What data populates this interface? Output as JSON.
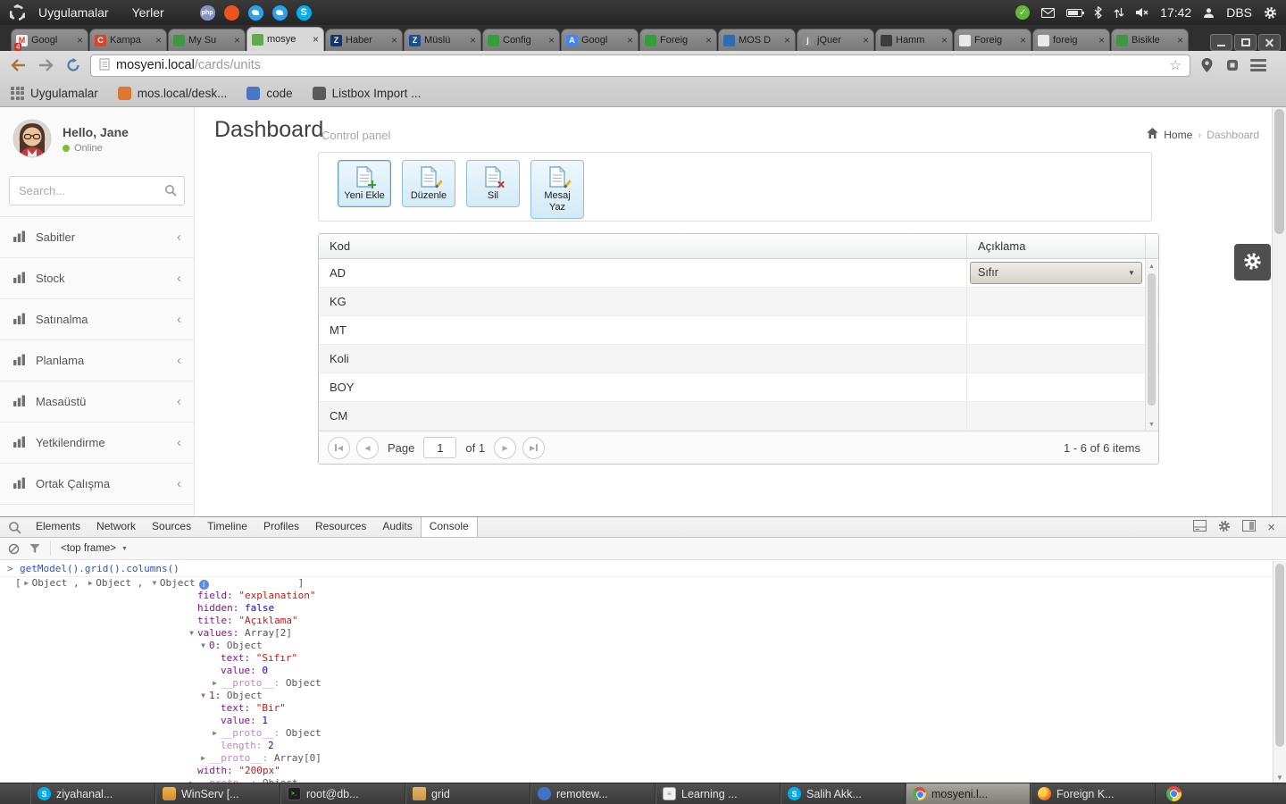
{
  "topbar": {
    "menus": [
      "Uygulamalar",
      "Yerler"
    ],
    "time": "17:42",
    "username": "DBS"
  },
  "browser": {
    "tabs": [
      {
        "title": "Googl",
        "fav_color": "#f1f1f1",
        "fav_glyph": "M",
        "fav_glyph_color": "#d93b2b",
        "badge": "4"
      },
      {
        "title": "Kampa",
        "fav_color": "#d9442c",
        "fav_glyph": "C",
        "fav_glyph_color": "#ffffff"
      },
      {
        "title": "My Su",
        "fav_color": "#3f9644",
        "fav_glyph": ""
      },
      {
        "title": "mosye",
        "fav_color": "#62a84e",
        "fav_glyph": "",
        "active": true
      },
      {
        "title": "Haber",
        "fav_color": "#14366b",
        "fav_glyph": "Z",
        "fav_glyph_color": "#ffffff"
      },
      {
        "title": "Müslü",
        "fav_color": "#1d4e93",
        "fav_glyph": "Z",
        "fav_glyph_color": "#ffffff"
      },
      {
        "title": "Config",
        "fav_color": "#35a03b",
        "fav_glyph": ""
      },
      {
        "title": "Googl",
        "fav_color": "#4285f4",
        "fav_glyph": "A",
        "fav_glyph_color": "#ffffff"
      },
      {
        "title": "Foreig",
        "fav_color": "#35a03b",
        "fav_glyph": ""
      },
      {
        "title": "MOS D",
        "fav_color": "#2d6db5",
        "fav_glyph": ""
      },
      {
        "title": "jQuer",
        "fav_color": "#8a8a8a",
        "fav_glyph": "j",
        "fav_glyph_color": "#ffffff"
      },
      {
        "title": "Hamm",
        "fav_color": "#3d3d3d",
        "fav_glyph": ""
      },
      {
        "title": "Foreig",
        "fav_color": "#e8e8e8",
        "fav_glyph": ""
      },
      {
        "title": "foreig",
        "fav_color": "#e8e8e8",
        "fav_glyph": ""
      },
      {
        "title": "Bisikle",
        "fav_color": "#3f9644",
        "fav_glyph": ""
      }
    ],
    "url": {
      "host": "mosyeni.local",
      "path": "/cards/units"
    },
    "bookmarks": [
      {
        "label": "Uygulamalar",
        "icon": "apps-grid"
      },
      {
        "label": "mos.local/desk...",
        "icon": "site",
        "icon_color": "#dd7733"
      },
      {
        "label": "code",
        "icon": "site",
        "icon_color": "#4a76c9"
      },
      {
        "label": "Listbox Import ...",
        "icon": "site",
        "icon_color": "#5a5a5a"
      }
    ]
  },
  "app": {
    "sidebar": {
      "greeting": "Hello, Jane",
      "status": "Online",
      "search_placeholder": "Search...",
      "items": [
        {
          "label": "Sabitler"
        },
        {
          "label": "Stock"
        },
        {
          "label": "Satınalma"
        },
        {
          "label": "Planlama"
        },
        {
          "label": "Masaüstü"
        },
        {
          "label": "Yetkilendirme"
        },
        {
          "label": "Ortak Çalışma"
        }
      ]
    },
    "header": {
      "title": "Dashboard",
      "subtitle": "Control panel",
      "breadcrumb": {
        "home": "Home",
        "separator": "›",
        "current": "Dashboard"
      }
    },
    "toolbar_buttons": [
      {
        "label": "Yeni Ekle",
        "icon": "document-add-icon"
      },
      {
        "label": "Düzenle",
        "icon": "document-edit-icon"
      },
      {
        "label": "Sil",
        "icon": "document-delete-icon"
      },
      {
        "label": "Mesaj Yaz",
        "icon": "document-message-icon"
      }
    ],
    "grid": {
      "columns": [
        "Kod",
        "Açıklama"
      ],
      "rows": [
        {
          "kod": "AD",
          "aciklama_editor_value": "Sıfır"
        },
        {
          "kod": "KG",
          "aciklama": ""
        },
        {
          "kod": "MT",
          "aciklama": ""
        },
        {
          "kod": "Koli",
          "aciklama": ""
        },
        {
          "kod": "BOY",
          "aciklama": ""
        },
        {
          "kod": "CM",
          "aciklama": ""
        }
      ],
      "pager": {
        "page_label": "Page",
        "page_value": "1",
        "of_label": "of 1",
        "summary": "1 - 6 of 6 items"
      }
    }
  },
  "devtools": {
    "tabs": [
      "Elements",
      "Network",
      "Sources",
      "Timeline",
      "Profiles",
      "Resources",
      "Audits",
      "Console"
    ],
    "active_tab": "Console",
    "frame_label": "<top frame>",
    "console": {
      "prompt": ">",
      "command": "getModel().grid().columns()",
      "result": {
        "open": "[",
        "separator": " , ",
        "close": "]",
        "items": [
          {
            "arrow": "collapsed",
            "label": "Object"
          },
          {
            "arrow": "collapsed",
            "label": "Object"
          },
          {
            "arrow": "expanded",
            "label": "Object",
            "info": true
          }
        ]
      },
      "tree": [
        {
          "d": 1,
          "key": "field",
          "val": "explanation",
          "type": "string"
        },
        {
          "d": 1,
          "key": "hidden",
          "val": "false",
          "type": "boolean"
        },
        {
          "d": 1,
          "key": "title",
          "val": "Açıklama",
          "type": "string"
        },
        {
          "d": 1,
          "key": "values",
          "val": "Array[2]",
          "type": "object",
          "arrow": "expanded"
        },
        {
          "d": 2,
          "key": "0",
          "val": "Object",
          "type": "object",
          "arrow": "expanded"
        },
        {
          "d": 3,
          "key": "text",
          "val": "Sıfır",
          "type": "string"
        },
        {
          "d": 3,
          "key": "value",
          "val": "0",
          "type": "number"
        },
        {
          "d": 3,
          "key": "__proto__",
          "val": "Object",
          "type": "object",
          "arrow": "collapsed",
          "faded": true
        },
        {
          "d": 2,
          "key": "1",
          "val": "Object",
          "type": "object",
          "arrow": "expanded"
        },
        {
          "d": 3,
          "key": "text",
          "val": "Bir",
          "type": "string"
        },
        {
          "d": 3,
          "key": "value",
          "val": "1",
          "type": "number"
        },
        {
          "d": 3,
          "key": "__proto__",
          "val": "Object",
          "type": "object",
          "arrow": "collapsed",
          "faded": true
        },
        {
          "d": 3,
          "key": "length",
          "val": "2",
          "type": "number",
          "faded": true
        },
        {
          "d": 2,
          "key": "__proto__",
          "val": "Array[0]",
          "type": "object",
          "arrow": "collapsed",
          "faded": true
        },
        {
          "d": 1,
          "key": "width",
          "val": "200px",
          "type": "string"
        },
        {
          "d": 1,
          "key": "__proto__",
          "val": "Object",
          "type": "object",
          "arrow": "collapsed",
          "faded": true
        }
      ]
    }
  },
  "taskbar": {
    "items": [
      {
        "label": "ziyahanal...",
        "icon": "skype"
      },
      {
        "label": "WinServ [...",
        "icon": "winserv"
      },
      {
        "label": "root@db...",
        "icon": "terminal"
      },
      {
        "label": "grid",
        "icon": "folder"
      },
      {
        "label": "remotew...",
        "icon": "remote"
      },
      {
        "label": "Learning ...",
        "icon": "document"
      },
      {
        "label": "Salih Akk...",
        "icon": "skype"
      },
      {
        "label": "mosyeni.l...",
        "icon": "chrome",
        "active": true
      },
      {
        "label": "Foreign K...",
        "icon": "ff"
      }
    ]
  }
}
